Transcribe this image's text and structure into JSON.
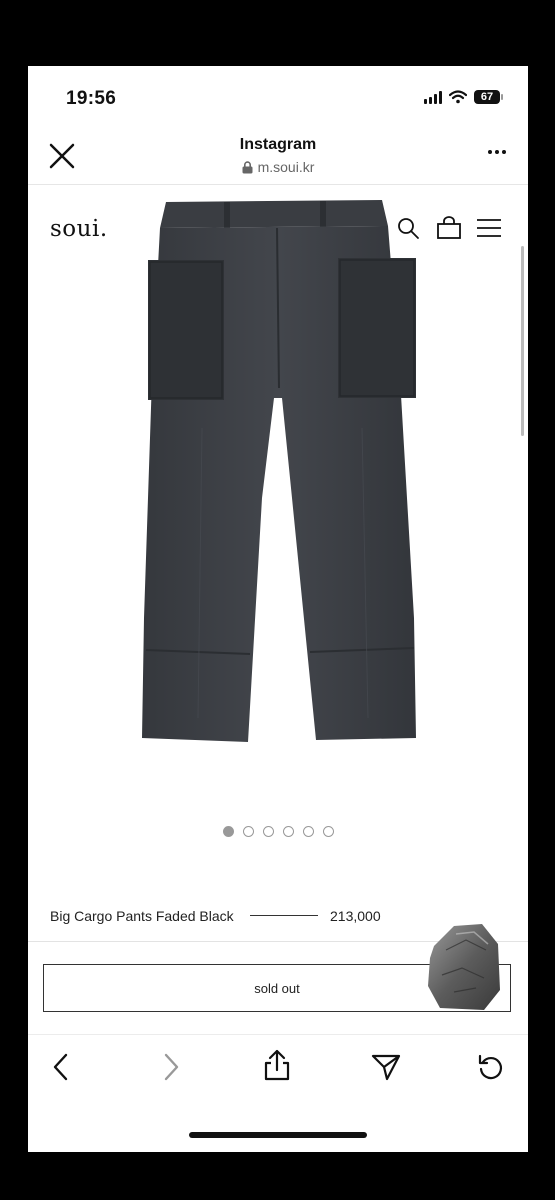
{
  "status_bar": {
    "time": "19:56",
    "battery": "67"
  },
  "browser": {
    "title": "Instagram",
    "url": "m.soui.kr"
  },
  "site": {
    "logo": "soui."
  },
  "carousel": {
    "count": 6,
    "active_index": 0
  },
  "product": {
    "name": "Big Cargo Pants Faded Black",
    "price": "213,000",
    "button_label": "sold out"
  },
  "icons": {
    "close": "close-icon",
    "more": "more-icon",
    "search": "search-icon",
    "bag": "bag-icon",
    "menu": "menu-icon",
    "back": "back-icon",
    "forward": "forward-icon",
    "share": "share-icon",
    "send": "send-icon",
    "reload": "reload-icon"
  },
  "colors": {
    "garment": "#3a3d42",
    "background": "#ffffff",
    "text": "#222222"
  }
}
